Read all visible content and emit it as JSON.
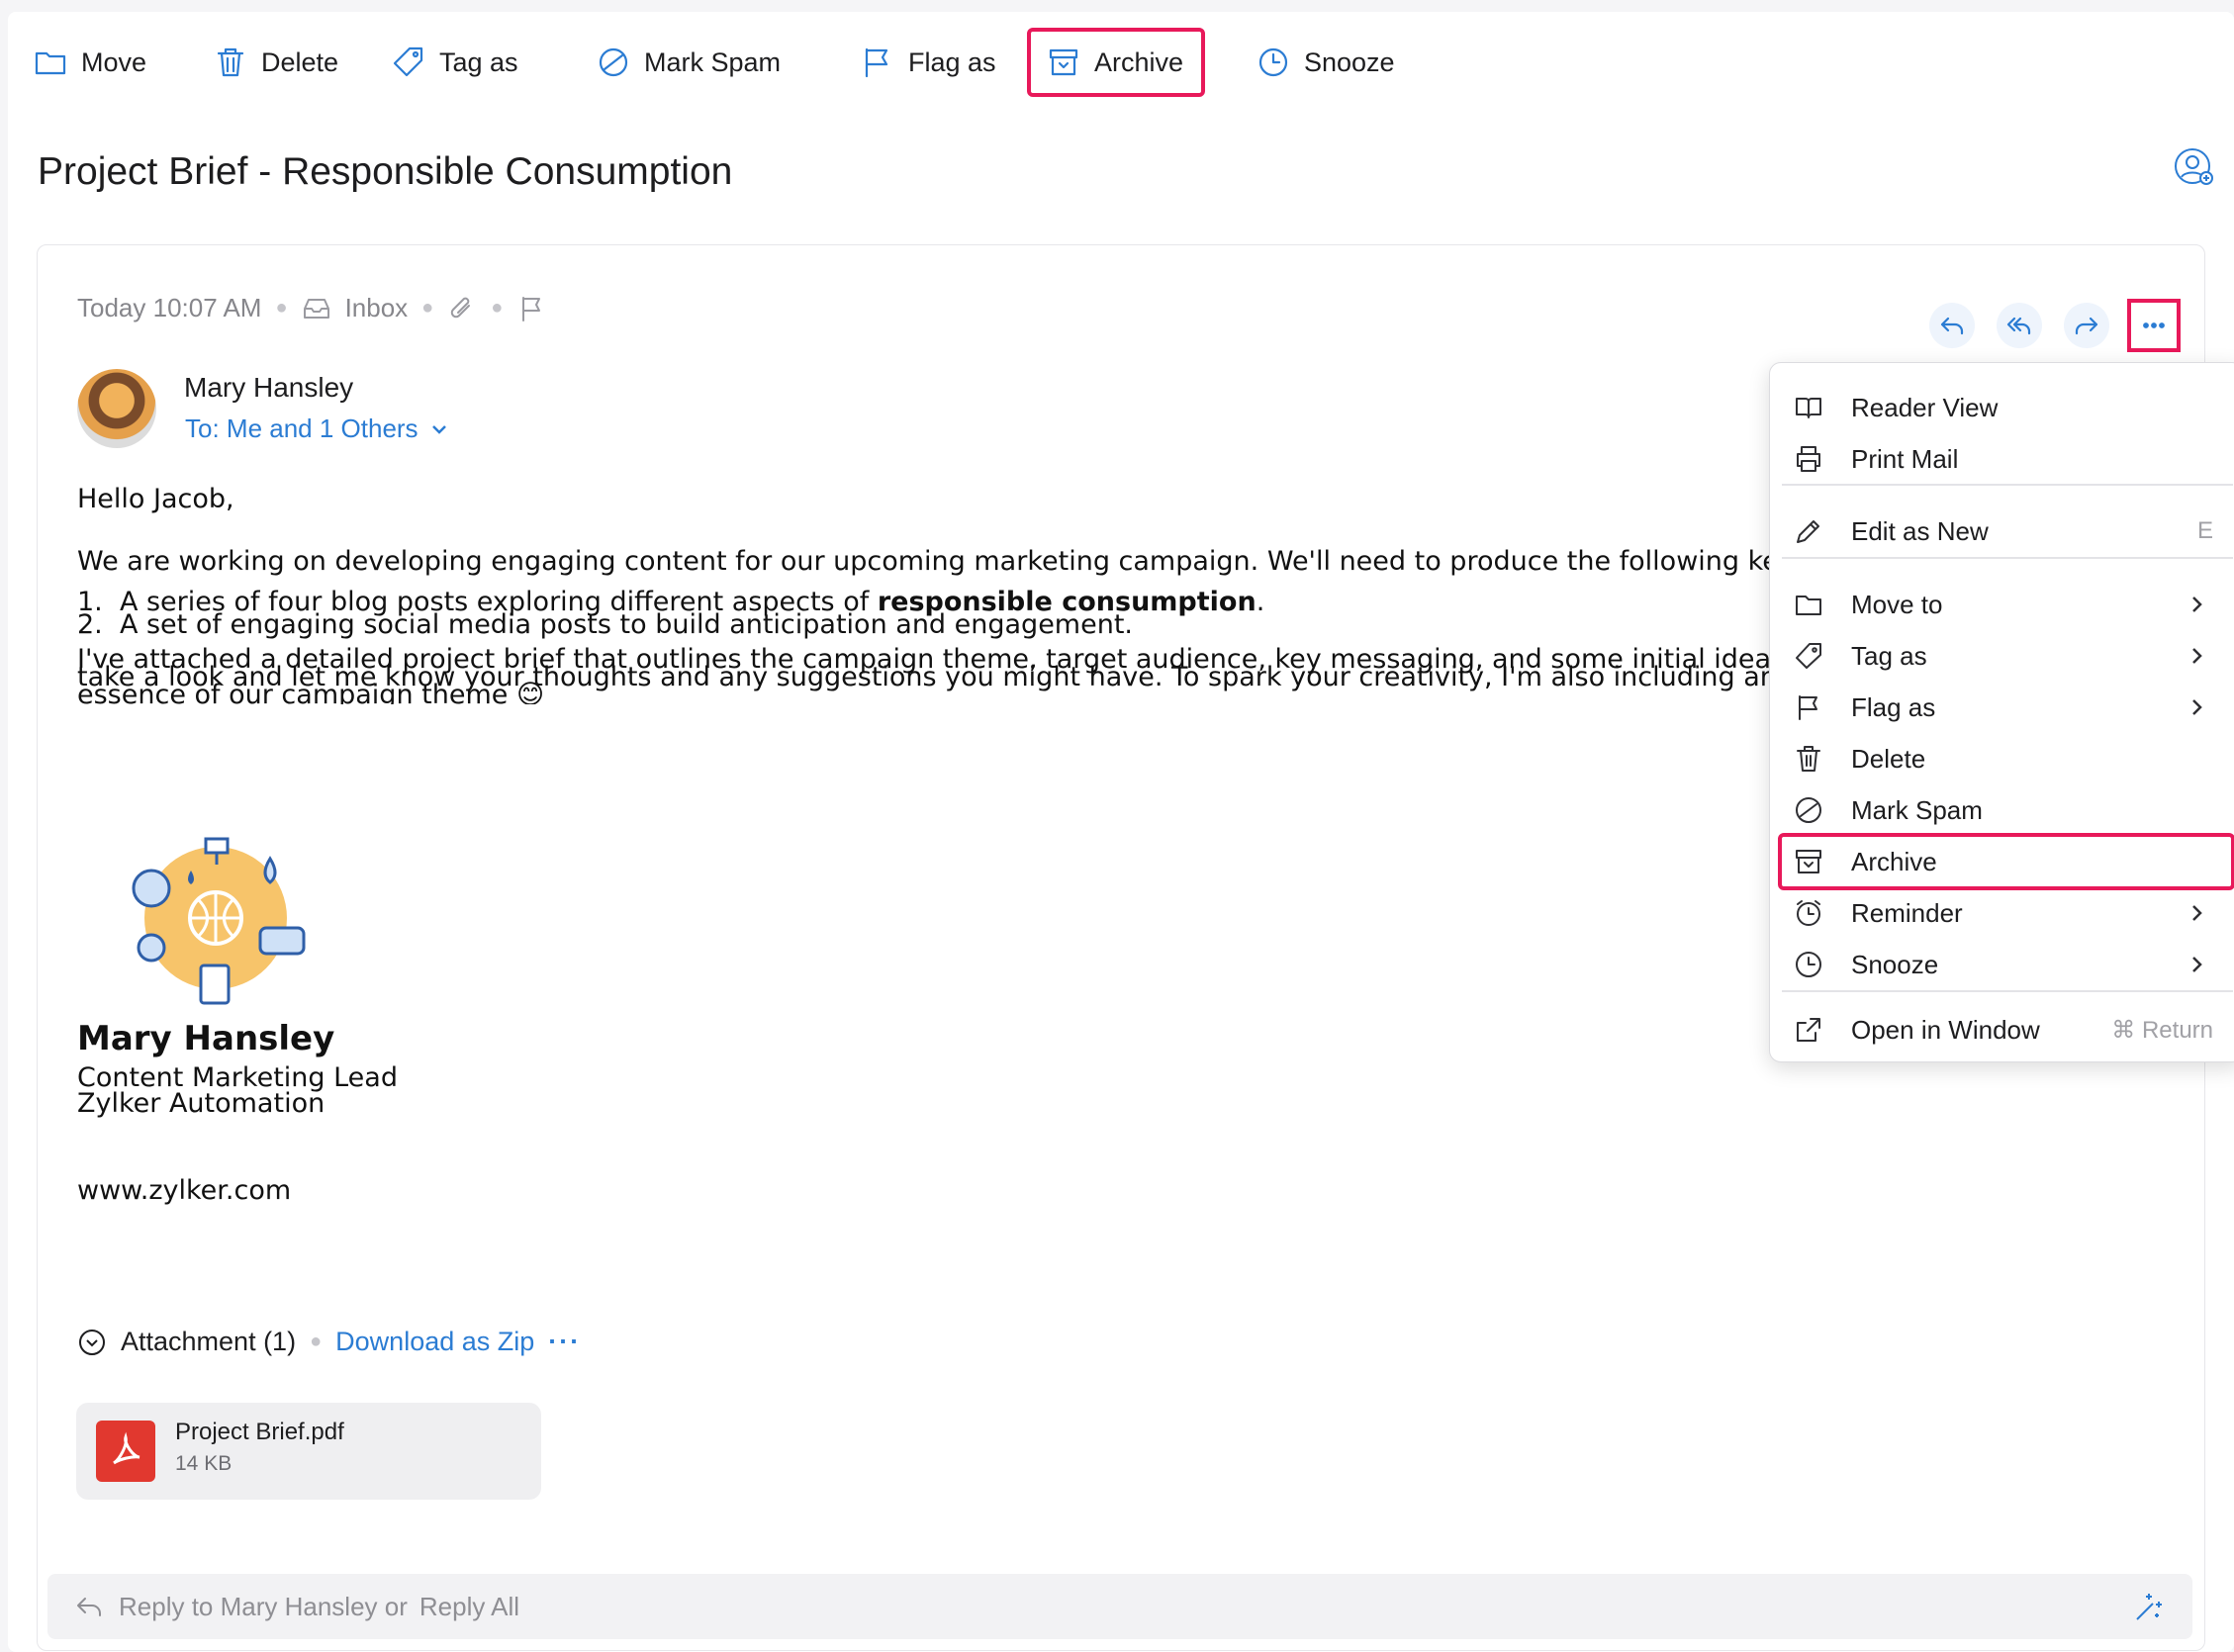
{
  "toolbar": {
    "items": [
      {
        "label": "Move",
        "icon": "folder-icon"
      },
      {
        "label": "Delete",
        "icon": "trash-icon"
      },
      {
        "label": "Tag as",
        "icon": "tag-icon"
      },
      {
        "label": "Mark Spam",
        "icon": "spam-icon"
      },
      {
        "label": "Flag as",
        "icon": "flag-icon"
      },
      {
        "label": "Archive",
        "icon": "archive-icon"
      },
      {
        "label": "Snooze",
        "icon": "clock-icon"
      }
    ]
  },
  "email": {
    "subject": "Project Brief - Responsible Consumption",
    "time": "Today 10:07 AM",
    "folder": "Inbox",
    "sender": "Mary Hansley",
    "to": "To: Me and 1 Others",
    "body": {
      "greeting": "Hello Jacob,",
      "para1": "We are working on developing engaging content for our upcoming marketing campaign. We'll need to produce the following key p",
      "item1_num": "1.",
      "item1_pre": "A series of four blog posts exploring different aspects of ",
      "item1_bold": "responsible consumption",
      "item1_post": ".",
      "item2_num": "2.",
      "item2": "A set of engaging social media posts to build anticipation and engagement.",
      "para2_line1": "I've attached a detailed project brief that outlines the campaign theme, target audience, key messaging, and some initial ideas fo",
      "para2_line2": "take a look and let me know your thoughts and any suggestions you might have. To spark your creativity, I'm also including an ir",
      "para2_line3": "essence of our campaign theme 😊"
    },
    "signature": {
      "name": "Mary Hansley",
      "title": "Content Marketing Lead",
      "company": "Zylker Automation",
      "website": "www.zylker.com"
    },
    "attachments": {
      "header": "Attachment (1)",
      "download": "Download as Zip",
      "more": "···",
      "files": [
        {
          "name": "Project Brief.pdf",
          "size": "14 KB"
        }
      ]
    },
    "reply": {
      "prefix": "Reply to Mary Hansley or",
      "reply_all": "Reply All"
    }
  },
  "menu": {
    "items": [
      {
        "label": "Reader View",
        "icon": "book-icon"
      },
      {
        "label": "Print Mail",
        "icon": "printer-icon"
      },
      {
        "label": "Edit as New",
        "icon": "pencil-icon",
        "shortcut": "E"
      },
      {
        "label": "Move to",
        "icon": "folder-icon",
        "submenu": true
      },
      {
        "label": "Tag as",
        "icon": "tag-icon",
        "submenu": true
      },
      {
        "label": "Flag as",
        "icon": "flag-icon",
        "submenu": true
      },
      {
        "label": "Delete",
        "icon": "trash-icon"
      },
      {
        "label": "Mark Spam",
        "icon": "spam-icon"
      },
      {
        "label": "Archive",
        "icon": "archive-icon",
        "highlighted": true
      },
      {
        "label": "Reminder",
        "icon": "alarm-icon",
        "submenu": true
      },
      {
        "label": "Snooze",
        "icon": "clock-icon",
        "submenu": true
      },
      {
        "label": "Open in Window",
        "icon": "external-window-icon",
        "shortcut": "⌘ Return"
      }
    ]
  },
  "colors": {
    "accent": "#2b7cd3",
    "highlight": "#e8195a",
    "pdf": "#e1382f"
  }
}
